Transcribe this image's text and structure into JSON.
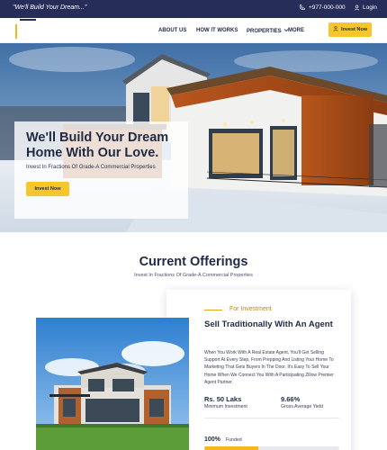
{
  "topbar": {
    "tagline": "\"We'll Build Your Dream...\"",
    "phone": "+977-000-000",
    "login": "Login"
  },
  "nav": {
    "items": [
      "ABOUT US",
      "HOW IT WORKS",
      "PROPERTIES",
      "MORE"
    ],
    "invest_button": "Invest Now"
  },
  "hero": {
    "title": "We'll Build Your Dream Home With Our Love.",
    "subtitle": "Invest In Fractions Of Grade-A Commercial Properties",
    "button": "Invest Now"
  },
  "offerings": {
    "title": "Current Offerings",
    "subtitle": "Invest In Fractions Of Grade-A Commercial Properties",
    "card": {
      "tag": "For Investment",
      "title": "Sell Traditionally With An Agent",
      "description": "When You Work With A Real Estate Agent, You'll Get Selling Support At Every Step, From Prepping And Listing Your Home To Marketing That Gets Buyers In The Door. It's Easy To Sell Your Home When We Connect You With A Participating Zillow Premier Agent Partner.",
      "min_investment_value": "Rs. 50 Laks",
      "min_investment_label": "Minimum Investment",
      "yield_value": "9.66%",
      "yield_label": "Gross Average Yield",
      "funded_pct_text": "100%",
      "funded_label": "Funded",
      "funded_fraction": 0.4
    }
  },
  "colors": {
    "topbar": "#262d59",
    "accent": "#f7c62b",
    "heading": "#1f2a44"
  }
}
